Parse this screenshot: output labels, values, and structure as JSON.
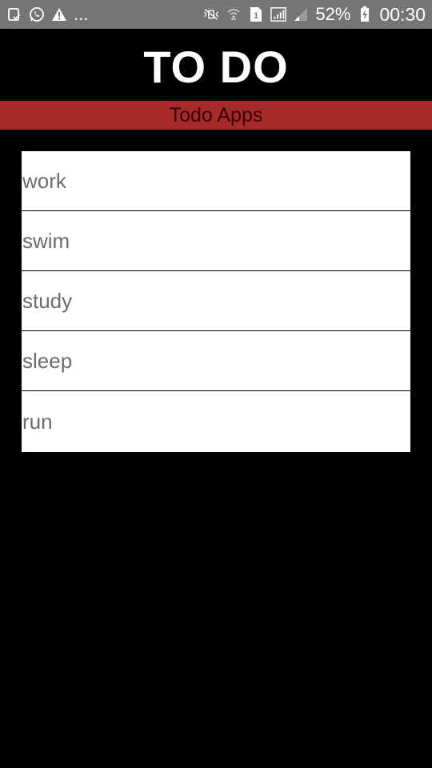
{
  "status_bar": {
    "left_icons": [
      "clipboard-check-icon",
      "whatsapp-icon",
      "warning-icon"
    ],
    "more": "...",
    "right_icons": [
      "mute-vibrate-icon",
      "wifi-icon",
      "sim-1-icon",
      "signal-full-icon",
      "signal-weak-icon"
    ],
    "battery": "52%",
    "time": "00:30"
  },
  "header": {
    "title": "TO DO"
  },
  "subtitle": "Todo Apps",
  "todos": [
    {
      "label": "work"
    },
    {
      "label": "swim"
    },
    {
      "label": "study"
    },
    {
      "label": "sleep"
    },
    {
      "label": "run"
    }
  ],
  "colors": {
    "status_bar": "#757575",
    "background": "#000000",
    "accent_bar": "#a52a2a",
    "list_bg": "#ffffff",
    "item_text": "#6b6b6b"
  }
}
